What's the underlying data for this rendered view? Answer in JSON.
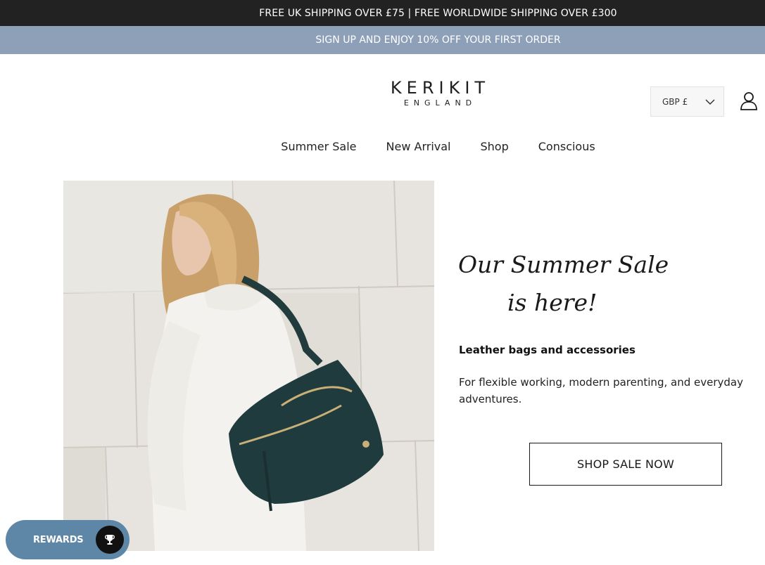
{
  "announcement": {
    "shipping": "FREE UK SHIPPING OVER £75 | FREE WORLDWIDE SHIPPING OVER £300",
    "signup": "SIGN UP AND ENJOY 10% OFF YOUR FIRST ORDER"
  },
  "header": {
    "logo_main": "KERIKIT",
    "logo_sub": "ENGLAND",
    "currency": "GBP £",
    "account_icon": "user-icon"
  },
  "nav": {
    "items": [
      {
        "label": "Summer Sale"
      },
      {
        "label": "New Arrival"
      },
      {
        "label": "Shop"
      },
      {
        "label": "Conscious"
      }
    ]
  },
  "hero": {
    "script_line1": "Our Summer Sale",
    "script_line2": "is here!",
    "subheading": "Leather bags and accessories",
    "description": "For flexible working, modern parenting, and everyday adventures.",
    "cta": "SHOP SALE NOW",
    "image": "model-with-teal-leather-bag"
  },
  "rewards": {
    "label": "REWARDS",
    "icon": "trophy-icon",
    "color": "#5e86a6"
  },
  "colors": {
    "topbar": "#222222",
    "promobar": "#8da0b8"
  }
}
